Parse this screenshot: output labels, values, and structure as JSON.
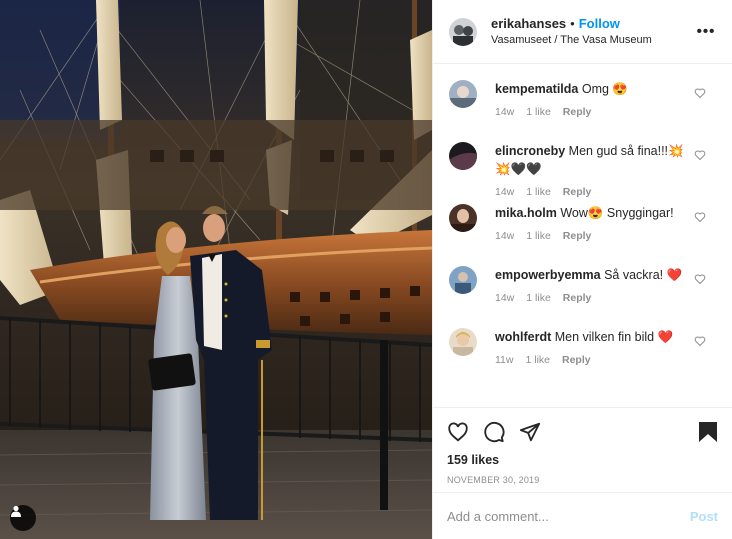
{
  "post": {
    "username": "erikahanses",
    "separator": "•",
    "follow_label": "Follow",
    "location": "Vasamuseet / The Vasa Museum",
    "more_label": "•••",
    "likes": "159 likes",
    "date": "NOVEMBER 30, 2019",
    "add_comment_placeholder": "Add a comment...",
    "post_label": "Post"
  },
  "comments": [
    {
      "username": "kempematilda",
      "text": "Omg 😍",
      "age": "14w",
      "likes": "1 like",
      "reply": "Reply"
    },
    {
      "username": "elincroneby",
      "text": "Men gud så fina!!!💥💥🖤🖤",
      "age": "14w",
      "likes": "1 like",
      "reply": "Reply"
    },
    {
      "username": "mika.holm",
      "text": "Wow😍 Snyggingar!",
      "age": "14w",
      "likes": "1 like",
      "reply": "Reply"
    },
    {
      "username": "empowerbyemma",
      "text": "Så vackra! ❤️",
      "age": "14w",
      "likes": "1 like",
      "reply": "Reply"
    },
    {
      "username": "wohlferdt",
      "text": "Men vilken fin bild ❤️",
      "age": "11w",
      "likes": "1 like",
      "reply": "Reply"
    }
  ],
  "icons": {
    "heart": "heart-icon",
    "comment": "comment-icon",
    "share": "share-icon",
    "save": "bookmark-icon",
    "tag": "user-tag-icon",
    "more": "more-options-icon"
  },
  "colors": {
    "accent": "#0095f6",
    "post_disabled": "#b2dffc",
    "meta": "#8e8e8e",
    "text": "#262626"
  }
}
